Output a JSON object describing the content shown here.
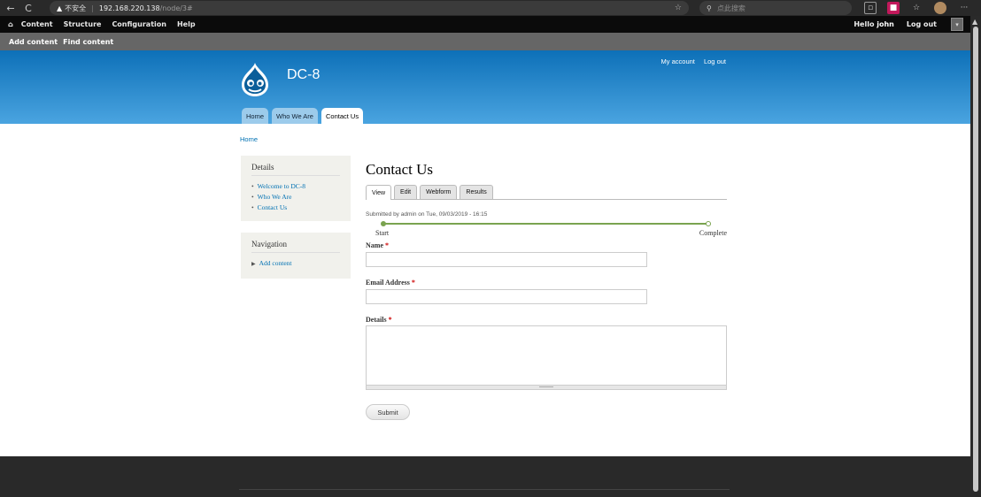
{
  "browser": {
    "back": "←",
    "reload": "C",
    "security_warning": "不安全",
    "url_host": "192.168.220.138",
    "url_path": "/node/3#",
    "search_placeholder": "点此搜索",
    "menu": "···"
  },
  "admin_toolbar": {
    "home_icon": "home-icon",
    "menu": [
      "Content",
      "Structure",
      "Configuration",
      "Help"
    ],
    "hello_prefix": "Hello ",
    "username": "john",
    "logout": "Log out"
  },
  "shortcuts": [
    "Add content",
    "Find content"
  ],
  "header": {
    "site_name": "DC-8",
    "secondary_menu": [
      "My account",
      "Log out"
    ],
    "main_tabs": [
      "Home",
      "Who We Are",
      "Contact Us"
    ],
    "active_tab": "Contact Us"
  },
  "breadcrumb": "Home",
  "sidebar": {
    "details": {
      "title": "Details",
      "items": [
        "Welcome to DC-8",
        "Who We Are",
        "Contact Us"
      ]
    },
    "navigation": {
      "title": "Navigation",
      "items": [
        "Add content"
      ]
    }
  },
  "main": {
    "title": "Contact Us",
    "tabs": [
      "View",
      "Edit",
      "Webform",
      "Results"
    ],
    "active_tab": "View",
    "submitted": "Submitted by admin on Tue, 09/03/2019 - 16:15",
    "progress": {
      "start": "Start",
      "end": "Complete"
    },
    "form": {
      "name_label": "Name",
      "email_label": "Email Address",
      "details_label": "Details",
      "required_mark": "*",
      "submit": "Submit"
    }
  },
  "colors": {
    "header_top": "#0d70b8",
    "header_bottom": "#4aa4e0",
    "link": "#0071b3",
    "progress": "#7aa34f",
    "required": "#cc0000"
  }
}
